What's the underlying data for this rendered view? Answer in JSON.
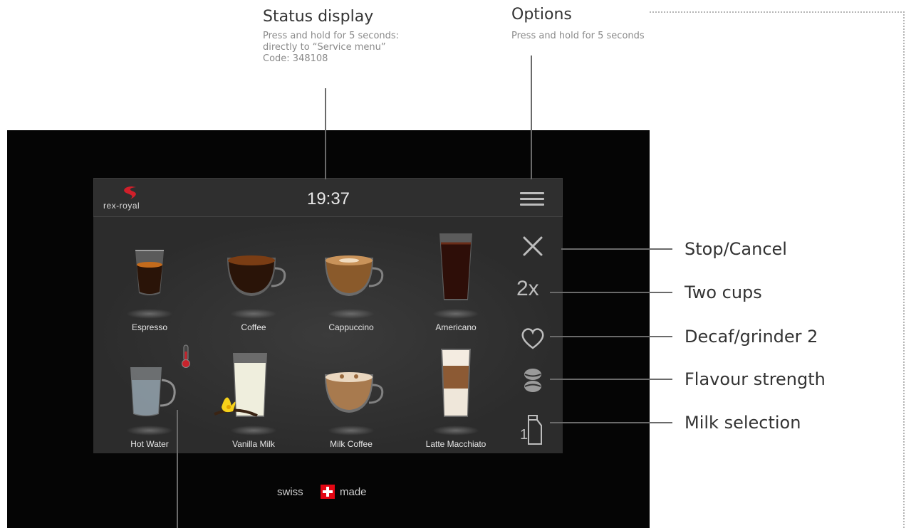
{
  "callouts": {
    "status_display": {
      "title": "Status display",
      "lines": [
        "Press and hold for 5 seconds:",
        "directly to “Service menu”",
        "Code: 348108"
      ]
    },
    "options": {
      "title": "Options",
      "lines": [
        "Press and hold for 5 seconds"
      ]
    },
    "side": {
      "stop_cancel": "Stop/Cancel",
      "two_cups": "Two cups",
      "decaf_grinder": "Decaf/grinder 2",
      "flavour_strength": "Flavour strength",
      "milk_selection": "Milk selection"
    }
  },
  "screen": {
    "brand": "rex-royal",
    "time": "19:37",
    "menu_icon": "hamburger-menu-icon",
    "beverages": [
      {
        "label": "Espresso",
        "icon": "espresso-cup-icon"
      },
      {
        "label": "Coffee",
        "icon": "coffee-cup-icon"
      },
      {
        "label": "Cappuccino",
        "icon": "cappuccino-cup-icon"
      },
      {
        "label": "Americano",
        "icon": "americano-glass-icon"
      },
      {
        "label": "Hot Water",
        "icon": "hot-water-glass-icon"
      },
      {
        "label": "Vanilla Milk",
        "icon": "vanilla-milk-glass-icon"
      },
      {
        "label": "Milk Coffee",
        "icon": "milk-coffee-cup-icon"
      },
      {
        "label": "Latte Macchiato",
        "icon": "latte-macchiato-glass-icon"
      }
    ],
    "side_controls": [
      {
        "name": "stop-cancel",
        "text": "",
        "icon": "close-icon"
      },
      {
        "name": "two-cups",
        "text": "2x",
        "icon": ""
      },
      {
        "name": "decaf",
        "text": "",
        "icon": "heart-icon"
      },
      {
        "name": "flavour-strength",
        "text": "",
        "icon": "coffee-bean-icon"
      },
      {
        "name": "milk-selection",
        "text": "1",
        "icon": "milk-carton-icon"
      }
    ]
  },
  "footer": {
    "swiss": "swiss",
    "made": "made"
  },
  "colors": {
    "device_bg": "#050505",
    "screen_bg": "#2f2f2f",
    "swiss_red": "#e30613",
    "brand_red": "#d01f2a",
    "thermometer_red": "#c8232c"
  }
}
